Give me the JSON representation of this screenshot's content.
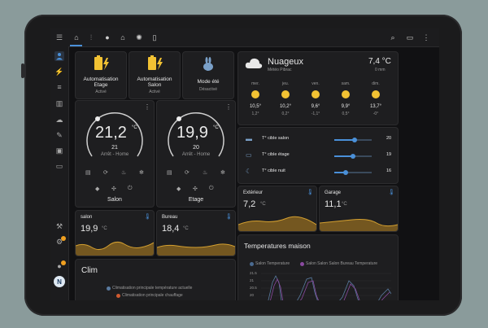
{
  "tiles": [
    {
      "icon": "battery-charging-icon",
      "line1": "Automatisation",
      "line2": "Etage",
      "status": "Activé"
    },
    {
      "icon": "battery-charging-icon",
      "line1": "Automatisation",
      "line2": "Salon",
      "status": "Activé"
    },
    {
      "icon": "rabbit-icon",
      "line1": "Mode été",
      "line2": "",
      "status": "Désactivé"
    }
  ],
  "weather": {
    "condition": "Nuageux",
    "location": "Météo Pibrac",
    "temp": "7,4 °C",
    "precip": "0 mm",
    "days": [
      {
        "name": "mer.",
        "high": "10,5°",
        "low": "1,2°"
      },
      {
        "name": "jeu.",
        "high": "10,2°",
        "low": "0,2°"
      },
      {
        "name": "ven.",
        "high": "9,6°",
        "low": "-1,1°"
      },
      {
        "name": "sam.",
        "high": "9,9°",
        "low": "0,5°"
      },
      {
        "name": "dim.",
        "high": "13,7°",
        "low": "-0°"
      }
    ]
  },
  "thermostats": [
    {
      "name": "Salon",
      "current": "21,2",
      "unit": "°C",
      "target": "21",
      "state": "Arrêt - Home"
    },
    {
      "name": "Etage",
      "current": "19,9",
      "unit": "°C",
      "target": "20",
      "state": "Arrêt - Home"
    }
  ],
  "setpoints": [
    {
      "label": "T° cible salon",
      "value": "20",
      "level": 0.55
    },
    {
      "label": "T° cible étage",
      "value": "19",
      "level": 0.5
    },
    {
      "label": "T° cible nuit",
      "value": "16",
      "level": 0.3
    }
  ],
  "sensors": [
    {
      "name": "salon",
      "value": "19,9",
      "unit": "°C"
    },
    {
      "name": "Bureau",
      "value": "18,4",
      "unit": "°C"
    },
    {
      "name": "Extérieur",
      "value": "7,2",
      "unit": "°C"
    },
    {
      "name": "Garage",
      "value": "11,1",
      "unit": "°C"
    }
  ],
  "clim": {
    "title": "Clim",
    "legend": [
      "Climatisation principale température actuelle",
      "Climatisation principale chauffage"
    ]
  },
  "temps": {
    "title": "Temperatures maison",
    "legend": [
      "Salon Temperature",
      "Salon Salon Salon Bureau Temperature"
    ],
    "ticks": [
      "21.5",
      "21",
      "20.5",
      "20"
    ]
  },
  "colors": {
    "accent": "#4a90d9",
    "yellow": "#f2c233",
    "area": "#8a6520",
    "line": "#d4a030",
    "badge": "#f0a020"
  }
}
